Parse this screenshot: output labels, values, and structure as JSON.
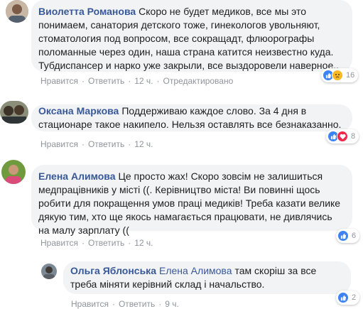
{
  "comments": [
    {
      "author": "Виолетта Романова",
      "text": "Скоро не будет медиков, все мы это понимаем, санатория детского тоже, гинекологов увольняют, стоматология под вопросом, все сокращадт, флюорографы поломанные через один, наша страна катится неизвестно куда. Тубдиспансер и нарко уже закрыли, все выздоровели наверное..",
      "like": "Нравится",
      "reply": "Ответить",
      "time": "12 ч.",
      "edited": "Отредактировано",
      "reactions_count": "16",
      "reaction_icons": [
        "like-icon",
        "sad-icon"
      ]
    },
    {
      "author": "Оксана Маркова",
      "text": "Поддерживаю каждое слово. За 4 дня в стационаре такое накипело. Нельзя оставлять все безнаказанно.",
      "like": "Нравится",
      "reply": "Ответить",
      "time": "12 ч.",
      "reactions_count": "8",
      "reaction_icons": [
        "like-icon",
        "love-icon"
      ]
    },
    {
      "author": "Елена Алимова",
      "text": "Це просто жах! Скоро зовсім не залишиться медпрацівників у місті ((. Керівництво міста! Ви повинні щось робити для покращення умов праці медиків! Треба казати велике дякую тим, хто ще якось намагається працювати, не дивлячись на малу зарплату ((",
      "like": "Нравится",
      "reply": "Ответить",
      "time": "12 ч.",
      "reactions_count": "6",
      "reaction_icons": [
        "like-icon"
      ]
    },
    {
      "author": "Ольга Яблонська",
      "mention": "Елена Алимова",
      "text": "там скоріш за все треба міняти керівний склад і начальство.",
      "like": "Нравится",
      "reply": "Ответить",
      "time": "9 ч.",
      "reactions_count": "2",
      "reaction_icons": [
        "like-icon"
      ]
    }
  ],
  "colors": {
    "name": "#385898",
    "bubble": "#f2f3f5",
    "meta": "#90949c",
    "like": "#3b83f6",
    "love": "#f0284a",
    "sad": "#f7b928"
  }
}
